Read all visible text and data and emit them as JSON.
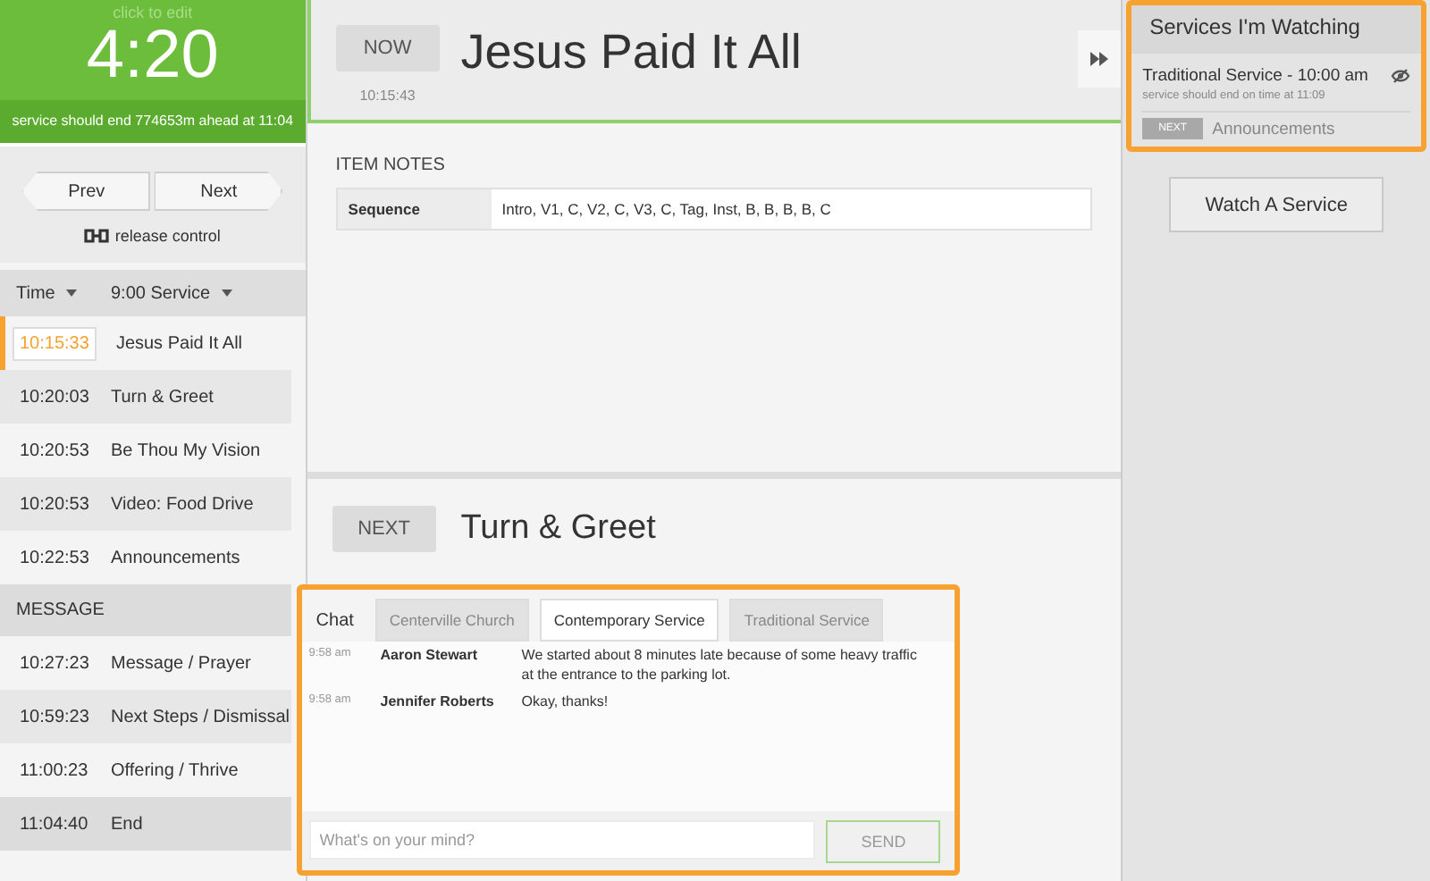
{
  "timer": {
    "hint": "click to edit",
    "time": "4:20",
    "status": "service should end 774653m ahead at 11:04"
  },
  "nav": {
    "prev": "Prev",
    "next": "Next",
    "release": "release control"
  },
  "plan_header": {
    "time_label": "Time",
    "service_label": "9:00 Service"
  },
  "plan_items": [
    {
      "kind": "item",
      "time": "10:15:33",
      "title": "Jesus Paid It All",
      "selected": true
    },
    {
      "kind": "item",
      "time": "10:20:03",
      "title": "Turn & Greet",
      "selected": false
    },
    {
      "kind": "item",
      "time": "10:20:53",
      "title": "Be Thou My Vision",
      "selected": false
    },
    {
      "kind": "item",
      "time": "10:20:53",
      "title": "Video: Food Drive",
      "selected": false
    },
    {
      "kind": "item",
      "time": "10:22:53",
      "title": "Announcements",
      "selected": false
    },
    {
      "kind": "section",
      "title": "MESSAGE",
      "selected": false
    },
    {
      "kind": "item",
      "time": "10:27:23",
      "title": "Message / Prayer",
      "selected": false
    },
    {
      "kind": "item",
      "time": "10:59:23",
      "title": "Next Steps / Dismissal",
      "selected": false
    },
    {
      "kind": "item",
      "time": "11:00:23",
      "title": "Offering / Thrive",
      "selected": false
    },
    {
      "kind": "end",
      "time": "11:04:40",
      "title": "End",
      "selected": false
    }
  ],
  "now": {
    "badge": "NOW",
    "title": "Jesus Paid It All",
    "time": "10:15:43"
  },
  "item_notes": {
    "heading": "ITEM NOTES",
    "rows": [
      {
        "label": "Sequence",
        "value": "Intro, V1, C, V2, C, V3, C, Tag, Inst, B, B, B, B, C"
      }
    ]
  },
  "next": {
    "badge": "NEXT",
    "title": "Turn & Greet"
  },
  "chat": {
    "label": "Chat",
    "tabs": [
      {
        "label": "Centerville Church",
        "selected": false
      },
      {
        "label": "Contemporary Service",
        "selected": true
      },
      {
        "label": "Traditional Service",
        "selected": false
      }
    ],
    "messages": [
      {
        "time": "9:58 am",
        "author": "Aaron Stewart",
        "text": "We started about 8 minutes late because of some heavy traffic at the entrance to the parking lot."
      },
      {
        "time": "9:58 am",
        "author": "Jennifer Roberts",
        "text": "Okay, thanks!"
      }
    ],
    "input": {
      "placeholder": "What's on your mind?"
    },
    "send": "SEND"
  },
  "watching": {
    "title": "Services I'm Watching",
    "services": [
      {
        "name": "Traditional Service - 10:00 am",
        "status": "service should end on time at 11:09",
        "next_badge": "NEXT",
        "next_title": "Announcements"
      }
    ],
    "button": "Watch A Service"
  }
}
